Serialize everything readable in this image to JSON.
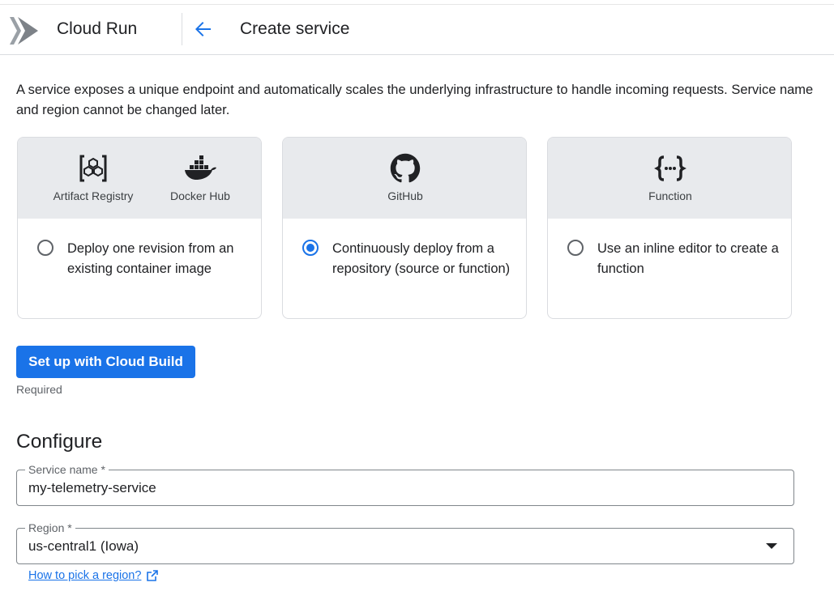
{
  "header": {
    "app_name": "Cloud Run",
    "page_title": "Create service",
    "logo_icon": "cloud-run-logo",
    "back_icon": "arrow-back-icon"
  },
  "intro_text": "A service exposes a unique endpoint and automatically scales the underlying infrastructure to handle incoming requests. Service name and region cannot be changed later.",
  "deploy_options": [
    {
      "sources": [
        {
          "label": "Artifact Registry",
          "icon": "artifact-registry-icon"
        },
        {
          "label": "Docker Hub",
          "icon": "docker-icon"
        }
      ],
      "description": "Deploy one revision from an existing container image",
      "selected": false
    },
    {
      "sources": [
        {
          "label": "GitHub",
          "icon": "github-icon"
        }
      ],
      "description": "Continuously deploy from a repository (source or function)",
      "selected": true
    },
    {
      "sources": [
        {
          "label": "Function",
          "icon": "function-braces-icon"
        }
      ],
      "description": "Use an inline editor to create a function",
      "selected": false
    }
  ],
  "cloud_build": {
    "button_label": "Set up with Cloud Build",
    "helper_text": "Required"
  },
  "configure": {
    "title": "Configure",
    "service_name": {
      "label": "Service name *",
      "value": "my-telemetry-service"
    },
    "region": {
      "label": "Region *",
      "value": "us-central1 (Iowa)"
    },
    "help_link": "How to pick a region?"
  },
  "colors": {
    "accent": "#1a73e8",
    "card_header_bg": "#e8eaed",
    "border": "#dadce0"
  }
}
